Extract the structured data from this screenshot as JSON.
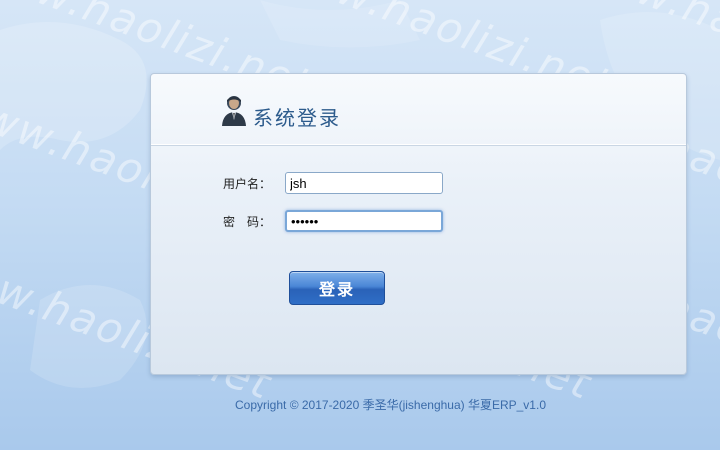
{
  "app": {
    "title": "系统登录",
    "watermark": "www.haolizi.net"
  },
  "form": {
    "username_label": "用户名：",
    "username_value": "jsh",
    "password_label": "密　码：",
    "password_value": "123456"
  },
  "buttons": {
    "login_label": "登录"
  },
  "footer": {
    "copyright": "Copyright © 2017-2020 季圣华(jishenghua) 华夏ERP_v1.0"
  },
  "icons": {
    "header": "user-avatar-icon"
  },
  "colors": {
    "title": "#2c5b8c",
    "button": "#2f6ec6",
    "copyright": "#3a6aa8"
  }
}
